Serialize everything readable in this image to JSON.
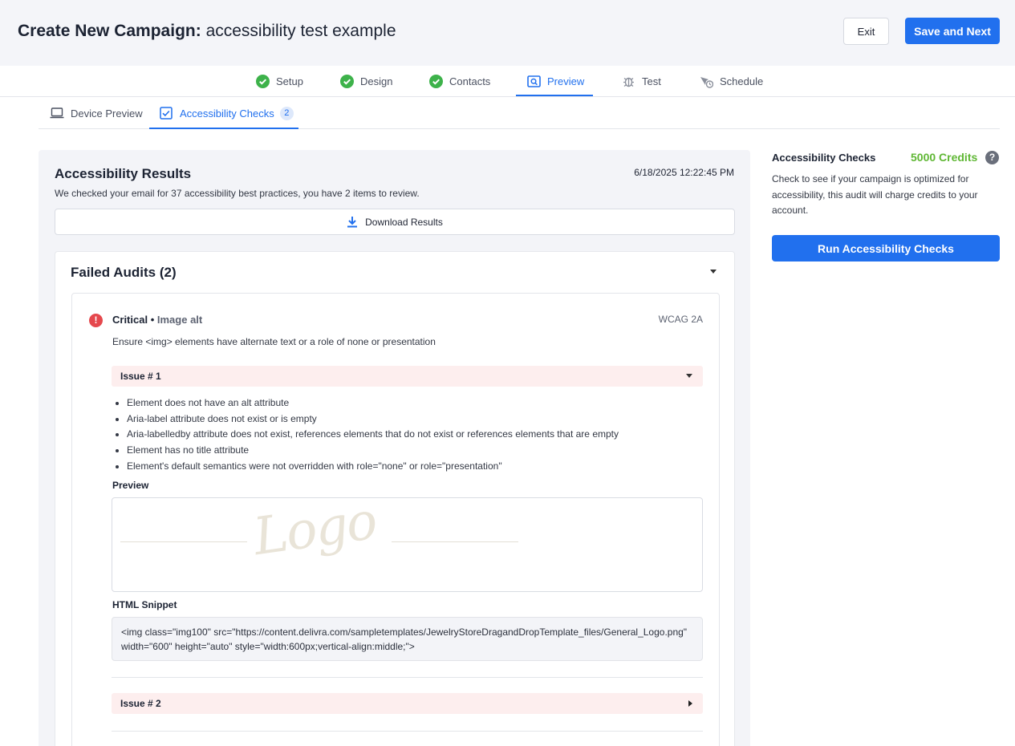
{
  "header": {
    "title_bold": "Create New Campaign:",
    "title_rest": "accessibility test example",
    "exit_label": "Exit",
    "save_label": "Save and Next"
  },
  "steps": [
    {
      "label": "Setup",
      "icon": "check-circle-icon",
      "state": "done"
    },
    {
      "label": "Design",
      "icon": "check-circle-icon",
      "state": "done"
    },
    {
      "label": "Contacts",
      "icon": "check-circle-icon",
      "state": "done"
    },
    {
      "label": "Preview",
      "icon": "preview-icon",
      "state": "active"
    },
    {
      "label": "Test",
      "icon": "bug-icon",
      "state": "pending"
    },
    {
      "label": "Schedule",
      "icon": "schedule-icon",
      "state": "pending"
    }
  ],
  "subtabs": {
    "device_preview": "Device Preview",
    "accessibility_checks": "Accessibility Checks",
    "accessibility_count": "2"
  },
  "results": {
    "title": "Accessibility Results",
    "date": "6/18/2025 12:22:45 PM",
    "description": "We checked your email for 37 accessibility best practices, you have 2 items to review.",
    "download_label": "Download Results"
  },
  "failed_audits": {
    "title": "Failed Audits (2)",
    "audit": {
      "severity": "Critical",
      "separator": "•",
      "rule": "Image alt",
      "wcag": "WCAG 2A",
      "description": "Ensure <img> elements have alternate text or a role of none or presentation",
      "issue1_label": "Issue # 1",
      "issue1_items": [
        "Element does not have an alt attribute",
        "Aria-label attribute does not exist or is empty",
        "Aria-labelledby attribute does not exist, references elements that do not exist or references elements that are empty",
        "Element has no title attribute",
        "Element's default semantics were not overridden with role=\"none\" or role=\"presentation\""
      ],
      "preview_label": "Preview",
      "preview_logo_text": "Logo",
      "snippet_label": "HTML Snippet",
      "snippet": "<img class=\"img100\" src=\"https://content.delivra.com/sampletemplates/JewelryStoreDragandDropTemplate_files/General_Logo.png\" width=\"600\" height=\"auto\" style=\"width:600px;vertical-align:middle;\">",
      "issue2_label": "Issue # 2"
    }
  },
  "sidebar": {
    "title": "Accessibility Checks",
    "credits": "5000 Credits",
    "help_icon": "?",
    "description": "Check to see if your campaign is optimized for accessibility, this audit will charge credits to your account.",
    "run_label": "Run Accessibility Checks"
  },
  "colors": {
    "accent": "#2170ee",
    "credits_green": "#5fb734",
    "critical_red": "#e5484d",
    "issue_bg": "#fdeeee"
  }
}
